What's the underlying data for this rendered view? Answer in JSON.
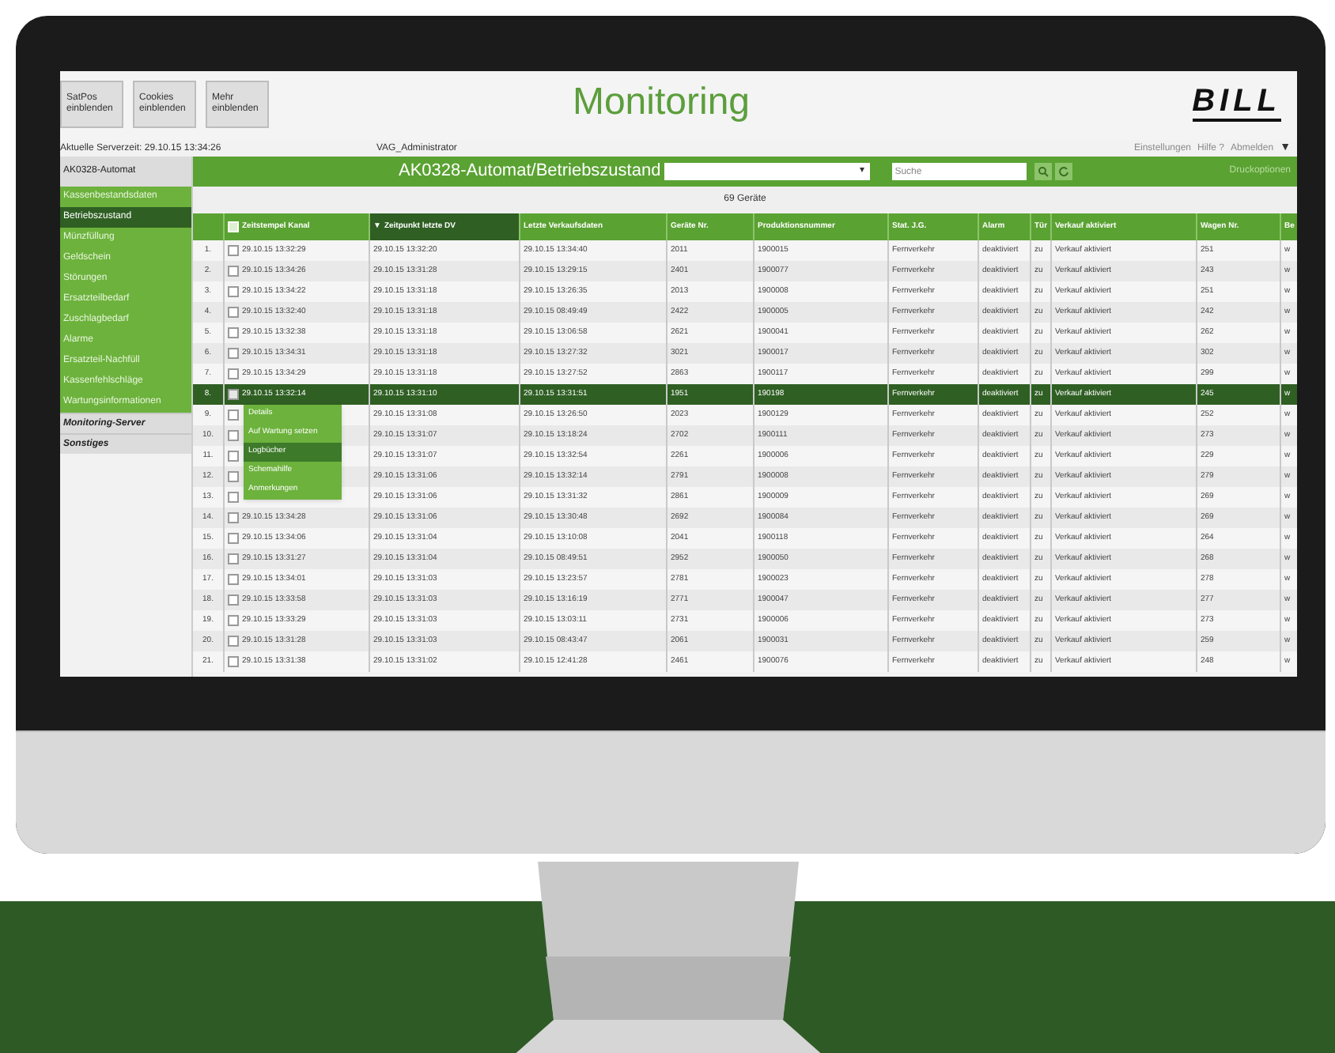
{
  "header": {
    "buttons": [
      "SatPos\neinblenden",
      "Cookies\neinblenden",
      "Mehr\neinblenden"
    ],
    "title": "Monitoring",
    "logo": "BILL"
  },
  "info_bar": {
    "server_time": "Aktuelle Serverzeit: 29.10.15 13:34:26",
    "user": "VAG_Administrator",
    "links": [
      "Einstellungen",
      "Hilfe ?",
      "Abmelden"
    ],
    "menu_arrow": "▼"
  },
  "sidebar": {
    "header": "AK0328-Automat",
    "items": [
      {
        "label": "Kassenbestandsdaten",
        "selected": false
      },
      {
        "label": "Betriebszustand",
        "selected": true
      },
      {
        "label": "Münzfüllung",
        "selected": false
      },
      {
        "label": "Geldschein",
        "selected": false
      },
      {
        "label": "Störungen",
        "selected": false
      },
      {
        "label": "Ersatzteilbedarf",
        "selected": false
      },
      {
        "label": "Zuschlagbedarf",
        "selected": false
      },
      {
        "label": "Alarme",
        "selected": false
      },
      {
        "label": "Ersatzteil-Nachfüll",
        "selected": false
      },
      {
        "label": "Kassenfehlschläge",
        "selected": false
      },
      {
        "label": "Wartungsinformationen",
        "selected": false
      }
    ],
    "sections": [
      "Monitoring-Server",
      "Sonstiges"
    ]
  },
  "toolbar": {
    "title": "AK0328-Automat/Betriebszustand",
    "dropdown_arrow": "▾",
    "search_placeholder": "Suche",
    "link": "Druckoptionen"
  },
  "count": "69 Geräte",
  "table": {
    "select_all": {
      "checked": false
    },
    "columns": [
      {
        "label": "Zeitstempel Kanal",
        "sorted": false
      },
      {
        "label": "Zeitpunkt letzte DV",
        "sorted": true,
        "sort_arrow": "▼"
      },
      {
        "label": "Letzte Verkaufsdaten",
        "sorted": false
      },
      {
        "label": "Geräte Nr.",
        "sorted": false
      },
      {
        "label": "Produktionsnummer",
        "sorted": false
      },
      {
        "label": "Stat. J.G.",
        "sorted": false
      },
      {
        "label": "Alarm",
        "sorted": false
      },
      {
        "label": "Tür",
        "sorted": false
      },
      {
        "label": "Verkauf aktiviert",
        "sorted": false
      },
      {
        "label": "Wagen Nr.",
        "sorted": false
      },
      {
        "label": "Be",
        "sorted": false
      }
    ],
    "rows": [
      {
        "n": "1.",
        "selected": false,
        "checked": false,
        "cells": [
          "29.10.15 13:32:29",
          "29.10.15 13:32:20",
          "29.10.15 13:34:40",
          "2011",
          "1900015",
          "Fernverkehr",
          "deaktiviert",
          "zu",
          "Verkauf aktiviert",
          "251",
          "w"
        ]
      },
      {
        "n": "2.",
        "selected": false,
        "checked": false,
        "cells": [
          "29.10.15 13:34:26",
          "29.10.15 13:31:28",
          "29.10.15 13:29:15",
          "2401",
          "1900077",
          "Fernverkehr",
          "deaktiviert",
          "zu",
          "Verkauf aktiviert",
          "243",
          "w"
        ]
      },
      {
        "n": "3.",
        "selected": false,
        "checked": false,
        "cells": [
          "29.10.15 13:34:22",
          "29.10.15 13:31:18",
          "29.10.15 13:26:35",
          "2013",
          "1900008",
          "Fernverkehr",
          "deaktiviert",
          "zu",
          "Verkauf aktiviert",
          "251",
          "w"
        ]
      },
      {
        "n": "4.",
        "selected": false,
        "checked": false,
        "cells": [
          "29.10.15 13:32:40",
          "29.10.15 13:31:18",
          "29.10.15 08:49:49",
          "2422",
          "1900005",
          "Fernverkehr",
          "deaktiviert",
          "zu",
          "Verkauf aktiviert",
          "242",
          "w"
        ]
      },
      {
        "n": "5.",
        "selected": false,
        "checked": false,
        "cells": [
          "29.10.15 13:32:38",
          "29.10.15 13:31:18",
          "29.10.15 13:06:58",
          "2621",
          "1900041",
          "Fernverkehr",
          "deaktiviert",
          "zu",
          "Verkauf aktiviert",
          "262",
          "w"
        ]
      },
      {
        "n": "6.",
        "selected": false,
        "checked": false,
        "cells": [
          "29.10.15 13:34:31",
          "29.10.15 13:31:18",
          "29.10.15 13:27:32",
          "3021",
          "1900017",
          "Fernverkehr",
          "deaktiviert",
          "zu",
          "Verkauf aktiviert",
          "302",
          "w"
        ]
      },
      {
        "n": "7.",
        "selected": false,
        "checked": false,
        "cells": [
          "29.10.15 13:34:29",
          "29.10.15 13:31:18",
          "29.10.15 13:27:52",
          "2863",
          "1900117",
          "Fernverkehr",
          "deaktiviert",
          "zu",
          "Verkauf aktiviert",
          "299",
          "w"
        ]
      },
      {
        "n": "8.",
        "selected": true,
        "checked": true,
        "cells": [
          "29.10.15 13:32:14",
          "29.10.15 13:31:10",
          "29.10.15 13:31:51",
          "1951",
          "190198",
          "Fernverkehr",
          "deaktiviert",
          "zu",
          "Verkauf aktiviert",
          "245",
          "w"
        ]
      },
      {
        "n": "9.",
        "selected": false,
        "checked": false,
        "cells": [
          null,
          "29.10.15 13:31:08",
          "29.10.15 13:26:50",
          "2023",
          "1900129",
          "Fernverkehr",
          "deaktiviert",
          "zu",
          "Verkauf aktiviert",
          "252",
          "w"
        ]
      },
      {
        "n": "10.",
        "selected": false,
        "checked": false,
        "cells": [
          null,
          "29.10.15 13:31:07",
          "29.10.15 13:18:24",
          "2702",
          "1900111",
          "Fernverkehr",
          "deaktiviert",
          "zu",
          "Verkauf aktiviert",
          "273",
          "w"
        ]
      },
      {
        "n": "11.",
        "selected": false,
        "checked": false,
        "cells": [
          null,
          "29.10.15 13:31:07",
          "29.10.15 13:32:54",
          "2261",
          "1900006",
          "Fernverkehr",
          "deaktiviert",
          "zu",
          "Verkauf aktiviert",
          "229",
          "w"
        ]
      },
      {
        "n": "12.",
        "selected": false,
        "checked": false,
        "cells": [
          null,
          "29.10.15 13:31:06",
          "29.10.15 13:32:14",
          "2791",
          "1900008",
          "Fernverkehr",
          "deaktiviert",
          "zu",
          "Verkauf aktiviert",
          "279",
          "w"
        ]
      },
      {
        "n": "13.",
        "selected": false,
        "checked": false,
        "cells": [
          null,
          "29.10.15 13:31:06",
          "29.10.15 13:31:32",
          "2861",
          "1900009",
          "Fernverkehr",
          "deaktiviert",
          "zu",
          "Verkauf aktiviert",
          "269",
          "w"
        ]
      },
      {
        "n": "14.",
        "selected": false,
        "checked": false,
        "cells": [
          "29.10.15 13:34:28",
          "29.10.15 13:31:06",
          "29.10.15 13:30:48",
          "2692",
          "1900084",
          "Fernverkehr",
          "deaktiviert",
          "zu",
          "Verkauf aktiviert",
          "269",
          "w"
        ]
      },
      {
        "n": "15.",
        "selected": false,
        "checked": false,
        "cells": [
          "29.10.15 13:34:06",
          "29.10.15 13:31:04",
          "29.10.15 13:10:08",
          "2041",
          "1900118",
          "Fernverkehr",
          "deaktiviert",
          "zu",
          "Verkauf aktiviert",
          "264",
          "w"
        ]
      },
      {
        "n": "16.",
        "selected": false,
        "checked": false,
        "cells": [
          "29.10.15 13:31:27",
          "29.10.15 13:31:04",
          "29.10.15 08:49:51",
          "2952",
          "1900050",
          "Fernverkehr",
          "deaktiviert",
          "zu",
          "Verkauf aktiviert",
          "268",
          "w"
        ]
      },
      {
        "n": "17.",
        "selected": false,
        "checked": false,
        "cells": [
          "29.10.15 13:34:01",
          "29.10.15 13:31:03",
          "29.10.15 13:23:57",
          "2781",
          "1900023",
          "Fernverkehr",
          "deaktiviert",
          "zu",
          "Verkauf aktiviert",
          "278",
          "w"
        ]
      },
      {
        "n": "18.",
        "selected": false,
        "checked": false,
        "cells": [
          "29.10.15 13:33:58",
          "29.10.15 13:31:03",
          "29.10.15 13:16:19",
          "2771",
          "1900047",
          "Fernverkehr",
          "deaktiviert",
          "zu",
          "Verkauf aktiviert",
          "277",
          "w"
        ]
      },
      {
        "n": "19.",
        "selected": false,
        "checked": false,
        "cells": [
          "29.10.15 13:33:29",
          "29.10.15 13:31:03",
          "29.10.15 13:03:11",
          "2731",
          "1900006",
          "Fernverkehr",
          "deaktiviert",
          "zu",
          "Verkauf aktiviert",
          "273",
          "w"
        ]
      },
      {
        "n": "20.",
        "selected": false,
        "checked": false,
        "cells": [
          "29.10.15 13:31:28",
          "29.10.15 13:31:03",
          "29.10.15 08:43:47",
          "2061",
          "1900031",
          "Fernverkehr",
          "deaktiviert",
          "zu",
          "Verkauf aktiviert",
          "259",
          "w"
        ]
      },
      {
        "n": "21.",
        "selected": false,
        "checked": false,
        "cells": [
          "29.10.15 13:31:38",
          "29.10.15 13:31:02",
          "29.10.15 12:41:28",
          "2461",
          "1900076",
          "Fernverkehr",
          "deaktiviert",
          "zu",
          "Verkauf aktiviert",
          "248",
          "w"
        ]
      }
    ]
  },
  "context_menu": [
    {
      "label": "Details",
      "selected": false
    },
    {
      "label": "Auf Wartung setzen",
      "selected": false
    },
    {
      "label": "Logbücher",
      "selected": true
    },
    {
      "label": "Schemahilfe",
      "selected": false
    },
    {
      "label": "Anmerkungen",
      "selected": false
    }
  ]
}
